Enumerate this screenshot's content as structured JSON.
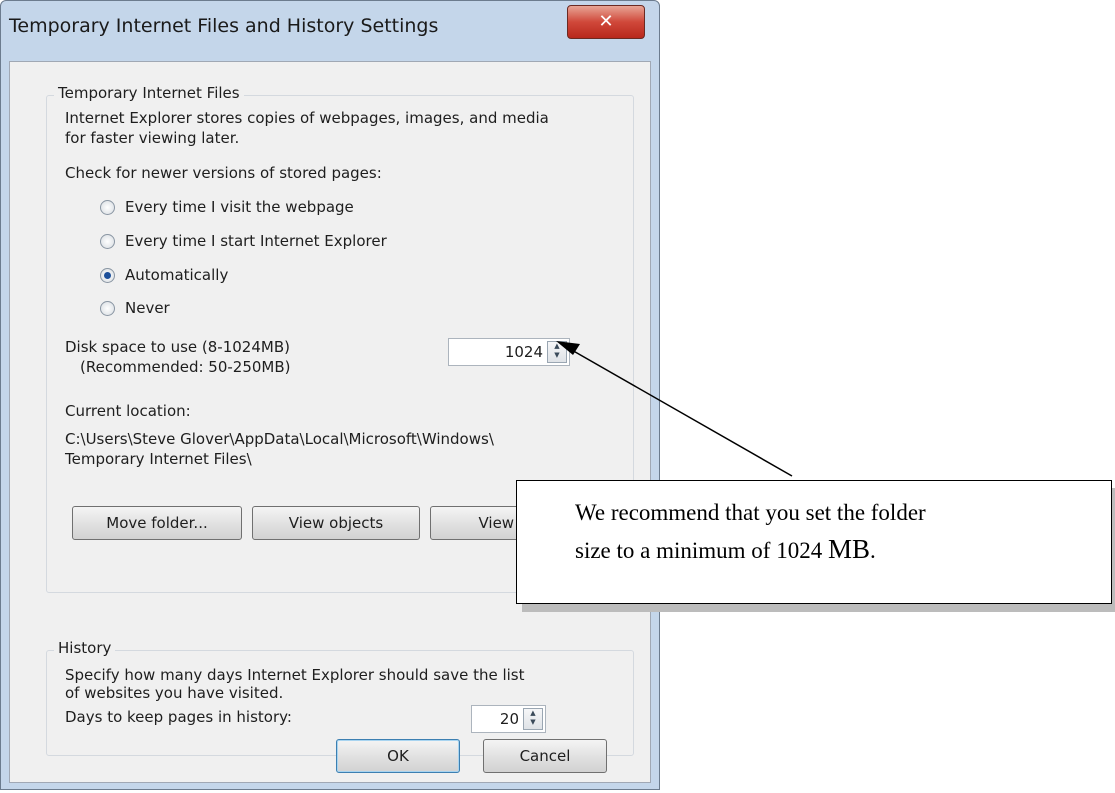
{
  "window": {
    "title": "Temporary Internet Files and History Settings",
    "close_label": "✕"
  },
  "temp_files": {
    "legend": "Temporary Internet Files",
    "description_line1": "Internet Explorer stores copies of webpages, images, and media",
    "description_line2": "for faster viewing later.",
    "check_label": "Check for newer versions of stored pages:",
    "options": [
      {
        "label": "Every time I visit the webpage",
        "selected": false
      },
      {
        "label": "Every time I start Internet Explorer",
        "selected": false
      },
      {
        "label": "Automatically",
        "selected": true
      },
      {
        "label": "Never",
        "selected": false
      }
    ],
    "disk_label_line1": "Disk space to use (8-1024MB)",
    "disk_label_line2": "(Recommended: 50-250MB)",
    "disk_value": "1024",
    "location_label": "Current location:",
    "location_line1": "C:\\Users\\Steve Glover\\AppData\\Local\\Microsoft\\Windows\\",
    "location_line2": "Temporary Internet Files\\",
    "buttons": {
      "move_folder": "Move folder...",
      "view_objects": "View objects",
      "view_files": "View files"
    }
  },
  "history": {
    "legend": "History",
    "description_line1": "Specify how many days Internet Explorer should save the list",
    "description_line2": "of websites you have visited.",
    "days_label": "Days to keep pages in history:",
    "days_value": "20"
  },
  "footer": {
    "ok_label": "OK",
    "cancel_label": "Cancel"
  },
  "callout": {
    "text_line1": "We recommend that you set the folder",
    "text_line2_prefix": "size to a minimum of 1024 ",
    "text_line2_unit": "MB",
    "text_line2_suffix": "."
  }
}
